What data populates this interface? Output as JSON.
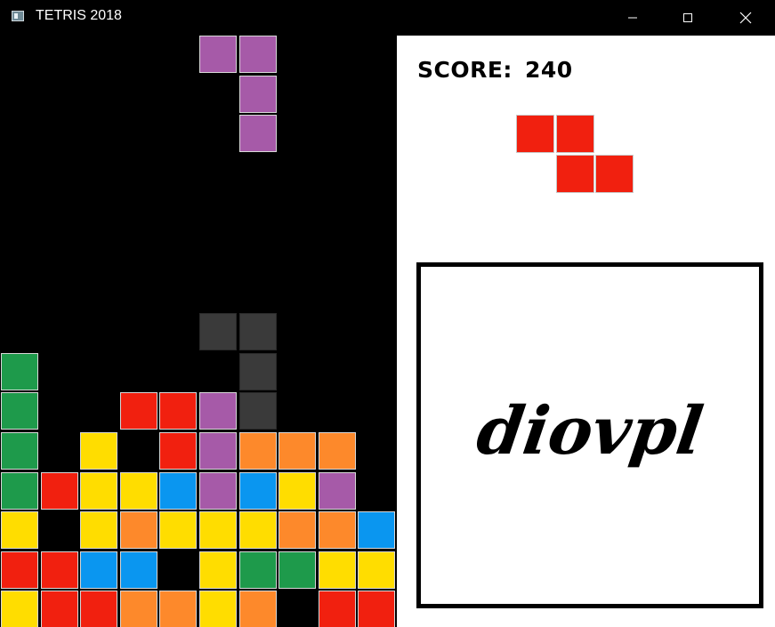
{
  "window": {
    "title": "TETRIS 2018",
    "controls": [
      "minimize-icon",
      "maximize-icon",
      "close-icon"
    ]
  },
  "colors": {
    "purple": "#a65aa8",
    "red": "#f1200f",
    "green": "#1e9a4b",
    "yellow": "#ffdd00",
    "orange": "#fd892b",
    "blue": "#0a96f0",
    "ghost": "#3a3a3a"
  },
  "board": {
    "columns": 10,
    "rows": 15,
    "falling_piece": {
      "color": "purple",
      "cells": [
        [
          5,
          0
        ],
        [
          6,
          0
        ],
        [
          6,
          1
        ],
        [
          6,
          2
        ]
      ]
    },
    "ghost_piece": {
      "color": "ghost",
      "cells": [
        [
          5,
          7
        ],
        [
          6,
          7
        ],
        [
          6,
          8
        ],
        [
          6,
          9
        ]
      ]
    },
    "stack_rows": [
      {
        "row": 8,
        "cells": [
          "green",
          null,
          null,
          null,
          null,
          null,
          null,
          null,
          null,
          null
        ]
      },
      {
        "row": 9,
        "cells": [
          "green",
          null,
          null,
          "red",
          "red",
          "purple",
          null,
          null,
          null,
          null
        ]
      },
      {
        "row": 10,
        "cells": [
          "green",
          null,
          "yellow",
          null,
          "red",
          "purple",
          "orange",
          "orange",
          "orange",
          null
        ]
      },
      {
        "row": 11,
        "cells": [
          "green",
          "red",
          "yellow",
          "yellow",
          "blue",
          "purple",
          "blue",
          "yellow",
          "purple",
          null
        ]
      },
      {
        "row": 12,
        "cells": [
          "yellow",
          null,
          "yellow",
          "orange",
          "yellow",
          "yellow",
          "yellow",
          "orange",
          "orange",
          "blue"
        ]
      },
      {
        "row": 13,
        "cells": [
          "red",
          "red",
          "blue",
          "blue",
          null,
          "yellow",
          "green",
          "green",
          "yellow",
          "yellow"
        ]
      },
      {
        "row": 14,
        "cells": [
          "yellow",
          "red",
          "red",
          "orange",
          "orange",
          "yellow",
          "orange",
          null,
          "red",
          "red"
        ]
      }
    ]
  },
  "sidebar": {
    "score_label": "SCORE:",
    "score_value": "240",
    "next_piece": {
      "color": "red",
      "cells": [
        [
          0,
          0
        ],
        [
          1,
          0
        ],
        [
          1,
          1
        ],
        [
          2,
          1
        ]
      ]
    },
    "captcha_text": "diovpl"
  }
}
